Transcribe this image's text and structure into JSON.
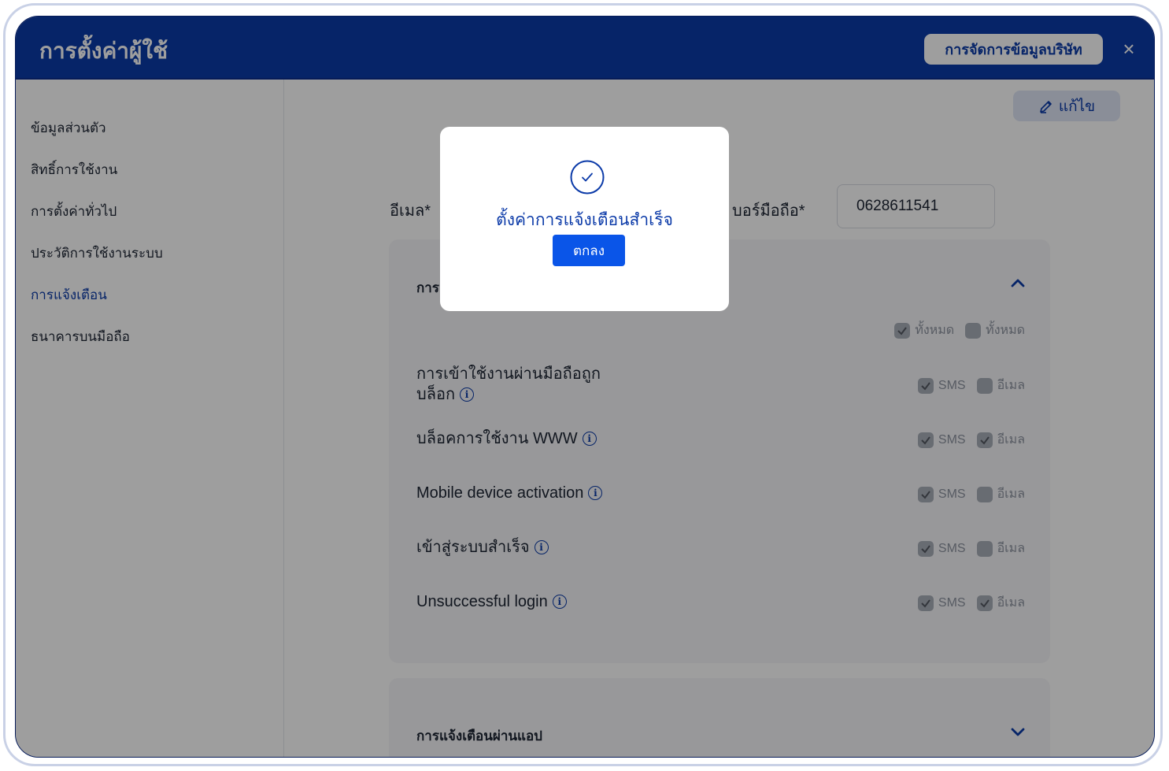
{
  "header": {
    "title": "การตั้งค่าผู้ใช้",
    "company_button": "การจัดการข้อมูลบริษัท",
    "close_icon": "×"
  },
  "sidebar": {
    "items": [
      {
        "label": "ข้อมูลส่วนตัว"
      },
      {
        "label": "สิทธิ์การใช้งาน"
      },
      {
        "label": "การตั้งค่าทั่วไป"
      },
      {
        "label": "ประวัติการใช้งานระบบ"
      },
      {
        "label": "การแจ้งเตือน"
      },
      {
        "label": "ธนาคารบนมือถือ"
      }
    ],
    "active_index": 4
  },
  "main": {
    "edit_button": "แก้ไข",
    "email_label": "อีเมล*",
    "phone_label": "บอร์มือถือ*",
    "phone_value": "0628611541",
    "section1_title": "การ",
    "select_all": {
      "sms_label": "ทั้งหมด",
      "email_label": "ทั้งหมด",
      "sms_checked": true,
      "email_checked": false
    },
    "rows": [
      {
        "label_line1": "การเข้าใช้งานผ่านมือถือถูก",
        "label_line2": "บล็อก",
        "sms": "SMS",
        "email": "อีเมล",
        "sms_checked": true,
        "email_checked": false
      },
      {
        "label": "บล็อคการใช้งาน WWW",
        "sms": "SMS",
        "email": "อีเมล",
        "sms_checked": true,
        "email_checked": true
      },
      {
        "label": "Mobile device activation",
        "sms": "SMS",
        "email": "อีเมล",
        "sms_checked": true,
        "email_checked": false
      },
      {
        "label": "เข้าสู่ระบบสำเร็จ",
        "sms": "SMS",
        "email": "อีเมล",
        "sms_checked": true,
        "email_checked": false
      },
      {
        "label": "Unsuccessful login",
        "sms": "SMS",
        "email": "อีเมล",
        "sms_checked": true,
        "email_checked": true
      }
    ],
    "section2_title": "การแจ้งเตือนผ่านแอป"
  },
  "modal": {
    "message": "ตั้งค่าการแจ้งเตือนสำเร็จ",
    "ok_button": "ตกลง",
    "icon": "check-circle-icon"
  },
  "colors": {
    "brand": "#0b3aa8",
    "primary_button": "#0a55e8"
  }
}
